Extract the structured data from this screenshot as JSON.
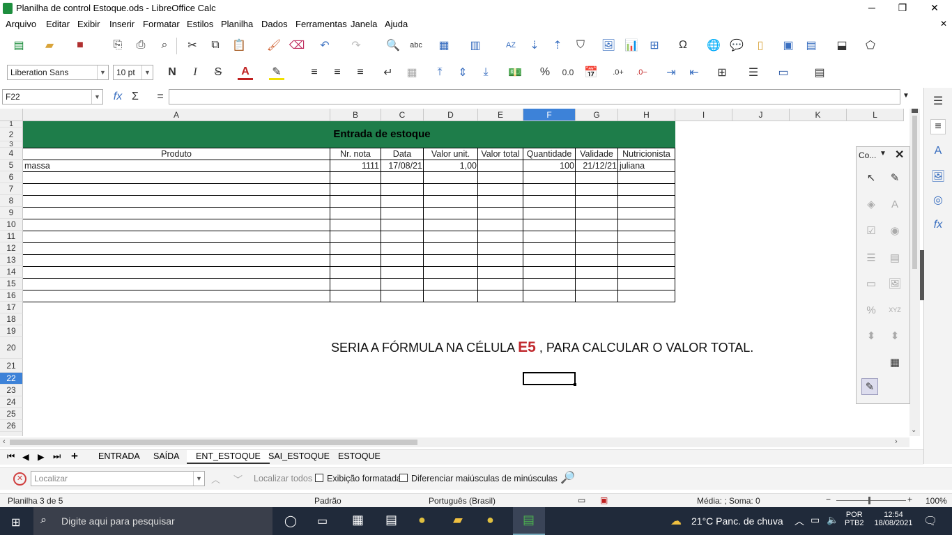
{
  "window": {
    "title": "Planilha de control Estoque.ods - LibreOffice Calc",
    "minimize": "─",
    "maximize": "❐",
    "close": "✕"
  },
  "menu": [
    "Arquivo",
    "Editar",
    "Exibir",
    "Inserir",
    "Formatar",
    "Estilos",
    "Planilha",
    "Dados",
    "Ferramentas",
    "Janela",
    "Ajuda"
  ],
  "font": {
    "name": "Liberation Sans",
    "size": "10 pt"
  },
  "format_buttons": {
    "bold": "N",
    "italic": "I",
    "strike": "S"
  },
  "number_buttons": {
    "percent": "%",
    "fixed": "0.0"
  },
  "namebox": "F22",
  "formula": "",
  "formula_icons": {
    "fx": "fx",
    "sum": "Σ",
    "equals": "="
  },
  "columns": [
    "A",
    "B",
    "C",
    "D",
    "E",
    "F",
    "G",
    "H",
    "I",
    "J",
    "K",
    "L"
  ],
  "rows": [
    "1",
    "2",
    "3",
    "4",
    "5",
    "6",
    "7",
    "8",
    "9",
    "10",
    "11",
    "12",
    "13",
    "14",
    "15",
    "16",
    "17",
    "18",
    "19",
    "20",
    "21",
    "22",
    "23",
    "24",
    "25",
    "26"
  ],
  "sheet": {
    "header_title": "Entrada de estoque",
    "col_headers": [
      "Produto",
      "Nr. nota",
      "Data",
      "Valor unit.",
      "Valor total",
      "Quantidade",
      "Validade",
      "Nutricionista"
    ],
    "row5": {
      "produto": "massa",
      "nota": "1111",
      "data": "17/08/21",
      "valor_unit": "1,00",
      "valor_total": "",
      "quantidade": "100",
      "validade": "21/12/21",
      "nutricionista": "juliana"
    },
    "note_prefix": "SERIA A FÓRMULA NA CÉLULA ",
    "note_cell": "E5",
    "note_suffix": " , PARA CALCULAR O VALOR TOTAL.",
    "header_bg": "#1e7d4a",
    "note_color": "#c0282d"
  },
  "float_panel": {
    "title": "Co..."
  },
  "tabs": [
    "ENTRADA",
    "SAÍDA",
    "ENT_ESTOQUE",
    "SAI_ESTOQUE",
    "ESTOQUE"
  ],
  "active_tab": "ENT_ESTOQUE",
  "find": {
    "placeholder": "Localizar",
    "find_all": "Localizar todos",
    "formatted": "Exibição formatada",
    "match_case": "Diferenciar maiúsculas de minúsculas"
  },
  "status": {
    "sheet": "Planilha 3 de 5",
    "style": "Padrão",
    "language": "Português (Brasil)",
    "sum": "Média: ; Soma: 0",
    "zoom": "100%"
  },
  "taskbar": {
    "search": "Digite aqui para pesquisar",
    "weather": "21°C  Panc. de chuva",
    "lang1": "POR",
    "lang2": "PTB2",
    "time": "12:54",
    "date": "18/08/2021"
  }
}
